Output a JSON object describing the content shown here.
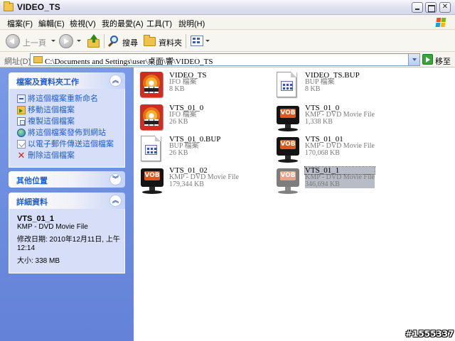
{
  "window": {
    "title": "VIDEO_TS"
  },
  "menu": [
    "檔案(F)",
    "編輯(E)",
    "檢視(V)",
    "我的最愛(A)",
    "工具(T)",
    "說明(H)"
  ],
  "toolbar": {
    "back_label": "上一頁",
    "search_label": "搜尋",
    "folders_label": "資料夾"
  },
  "address": {
    "label": "網址(D)",
    "path": "C:\\Documents and Settings\\user\\桌面\\響\\VIDEO_TS",
    "go_label": "移至"
  },
  "sidebar": {
    "tasks": {
      "title": "檔案及資料夾工作",
      "items": [
        {
          "label": "將這個檔案重新命名",
          "icon": "rename-icon"
        },
        {
          "label": "移動這個檔案",
          "icon": "move-icon"
        },
        {
          "label": "複製這個檔案",
          "icon": "copy-icon"
        },
        {
          "label": "將這個檔案發佈到網站",
          "icon": "web-publish-icon"
        },
        {
          "label": "以電子郵件傳送這個檔案",
          "icon": "email-icon"
        },
        {
          "label": "刪除這個檔案",
          "icon": "delete-icon"
        }
      ]
    },
    "places": {
      "title": "其他位置"
    },
    "details": {
      "title": "詳細資料",
      "name": "VTS_01_1",
      "type": "KMP - DVD Movie File",
      "modified_1": "修改日期: 2010年12月11日, 上午",
      "modified_2": "12:14",
      "size": "大小: 338 MB"
    }
  },
  "files": [
    {
      "name": "VIDEO_TS",
      "type": "IFO 檔案",
      "size": "8 KB",
      "icon": "ifo-file-icon"
    },
    {
      "name": "VIDEO_TS.BUP",
      "type": "BUP 檔案",
      "size": "8 KB",
      "icon": "bup-file-icon"
    },
    {
      "name": "VTS_01_0",
      "type": "IFO 檔案",
      "size": "26 KB",
      "icon": "ifo-file-icon"
    },
    {
      "name": "VTS_01_0",
      "type": "KMP - DVD Movie File",
      "size": "1,338 KB",
      "icon": "vob-file-icon"
    },
    {
      "name": "VTS_01_0.BUP",
      "type": "BUP 檔案",
      "size": "26 KB",
      "icon": "bup-file-icon"
    },
    {
      "name": "VTS_01_01",
      "type": "KMP - DVD Movie File",
      "size": "170,068 KB",
      "icon": "vob-file-icon"
    },
    {
      "name": "VTS_01_02",
      "type": "KMP - DVD Movie File",
      "size": "179,344 KB",
      "icon": "vob-file-icon"
    },
    {
      "name": "VTS_01_1",
      "type": "KMP - DVD Movie File",
      "size": "346,694 KB",
      "icon": "vob-file-icon",
      "selected": true
    }
  ],
  "vob_badge": "VOB",
  "watermark": "#1555337",
  "colors": {
    "sidebar_bg": "#6f8fe0",
    "panel_title": "#215dc6",
    "selection": "#b8bcc6"
  }
}
